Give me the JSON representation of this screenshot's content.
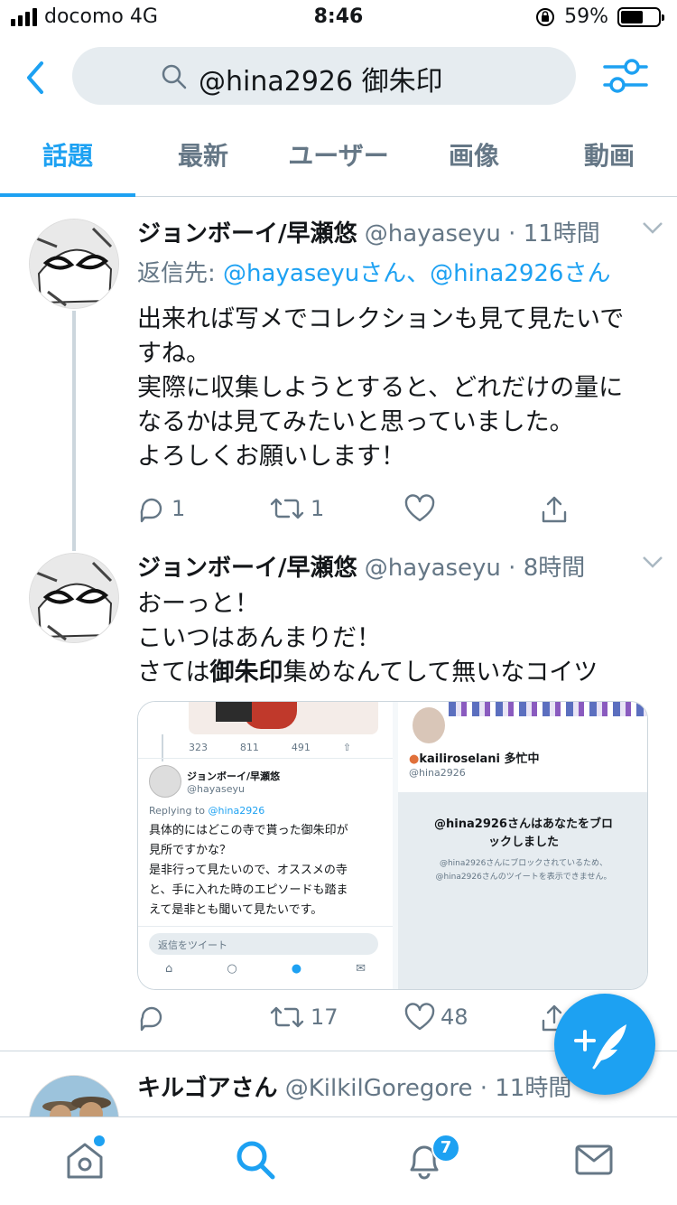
{
  "status": {
    "carrier": "docomo 4G",
    "time": "8:46",
    "battery": "59%",
    "battery_level": 0.59
  },
  "header": {
    "search_query": "@hina2926 御朱印"
  },
  "tabs": [
    {
      "label": "話題",
      "active": true
    },
    {
      "label": "最新"
    },
    {
      "label": "ユーザー"
    },
    {
      "label": "画像"
    },
    {
      "label": "動画"
    }
  ],
  "tweets": [
    {
      "name": "ジョンボーイ/早瀬悠",
      "handle": "@hayaseyu",
      "time": "· 11時間",
      "reply_prefix": "返信先: ",
      "reply_to": "@hayaseyuさん、@hina2926さん",
      "lines": [
        "出来れば写メでコレクションも見て見たいで",
        "すね。",
        "実際に収集しようとすると、どれだけの量に",
        "なるかは見てみたいと思っていました。",
        "よろしくお願いします！"
      ],
      "replies": "1",
      "retweets": "1",
      "likes": ""
    },
    {
      "name": "ジョンボーイ/早瀬悠",
      "handle": "@hayaseyu",
      "time": "· 8時間",
      "line1": "おーっと！",
      "line2": "こいつはあんまりだ！",
      "line3_a": "さては",
      "line3_b": "御朱印",
      "line3_c": "集めなんてして無いなコイツ",
      "replies": "",
      "retweets": "17",
      "likes": "48",
      "media": {
        "left": {
          "counts": [
            "323",
            "811",
            "491"
          ],
          "name": "ジョンボーイ/早瀬悠",
          "handle": "@hayaseyu",
          "replying_prefix": "Replying to ",
          "replying_to": "@hina2926",
          "body": [
            "具体的にはどこの寺で貰った御朱印が",
            "見所ですかな？",
            "是非行って見たいので、オススメの寺",
            "と、手に入れた時のエピソードも踏ま",
            "えて是非とも聞いて見たいです。"
          ],
          "reply_placeholder": "返信をツイート"
        },
        "right": {
          "name": "kailiroselani",
          "name_suffix": "多忙中",
          "handle": "@hina2926",
          "blocked_title_1": "@hina2926さんはあなたをブロ",
          "blocked_title_2": "ックしました",
          "blocked_desc_1": "@hina2926さんにブロックされているため、",
          "blocked_desc_2": "@hina2926さんのツイートを表示できません。"
        }
      }
    },
    {
      "name": "キルゴアさん",
      "handle": "@KilkilGoregore",
      "time": "· 11時間"
    }
  ],
  "bottom_nav": {
    "notifications_badge": "7"
  },
  "colors": {
    "accent": "#1da1f2",
    "secondary": "#657786",
    "border": "#ccd6dd",
    "search_bg": "#e6ecf0"
  }
}
